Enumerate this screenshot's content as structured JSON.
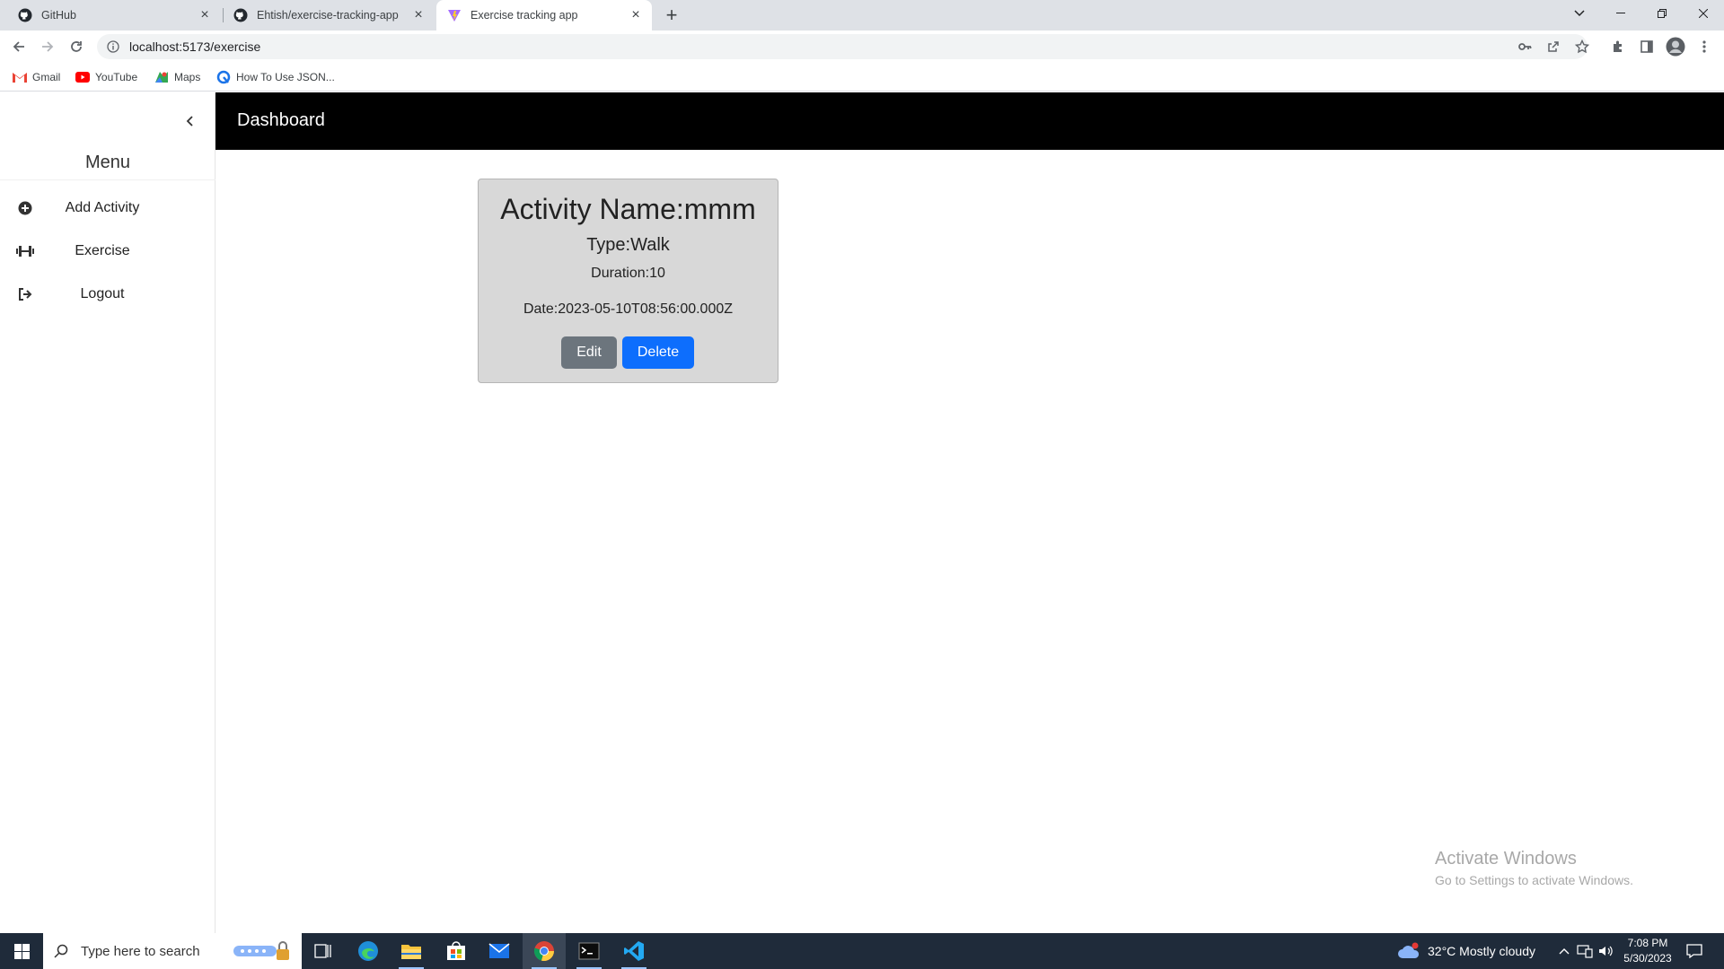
{
  "browser": {
    "tabs": [
      {
        "title": "GitHub",
        "icon": "github-icon",
        "active": false
      },
      {
        "title": "Ehtish/exercise-tracking-app",
        "icon": "github-icon",
        "active": false
      },
      {
        "title": "Exercise tracking app",
        "icon": "vite-icon",
        "active": true
      }
    ],
    "url": "localhost:5173/exercise",
    "bookmarks": [
      {
        "label": "Gmail",
        "icon": "gmail-icon"
      },
      {
        "label": "YouTube",
        "icon": "youtube-icon"
      },
      {
        "label": "Maps",
        "icon": "maps-icon"
      },
      {
        "label": "How To Use JSON...",
        "icon": "bookmark-site-icon"
      }
    ]
  },
  "sidebar": {
    "menu_title": "Menu",
    "items": [
      {
        "label": "Add Activity",
        "icon": "plus-circle-icon"
      },
      {
        "label": "Exercise",
        "icon": "dumbbell-icon"
      },
      {
        "label": "Logout",
        "icon": "logout-icon"
      }
    ]
  },
  "header": {
    "title": "Dashboard"
  },
  "activity": {
    "name": "Activity Name:mmm",
    "type": "Type:Walk",
    "duration": "Duration:10",
    "date": "Date:2023-05-10T08:56:00.000Z",
    "edit_label": "Edit",
    "delete_label": "Delete"
  },
  "watermark": {
    "line1": "Activate Windows",
    "line2": "Go to Settings to activate Windows."
  },
  "taskbar": {
    "search_placeholder": "Type here to search",
    "weather": "32°C  Mostly cloudy",
    "time": "7:08 PM",
    "date": "5/30/2023"
  },
  "colors": {
    "header_bg": "#000000",
    "card_bg": "#d8d8d8",
    "edit_button": "#6c757d",
    "delete_button": "#0d6efd",
    "taskbar_bg": "#1f2b3a"
  }
}
